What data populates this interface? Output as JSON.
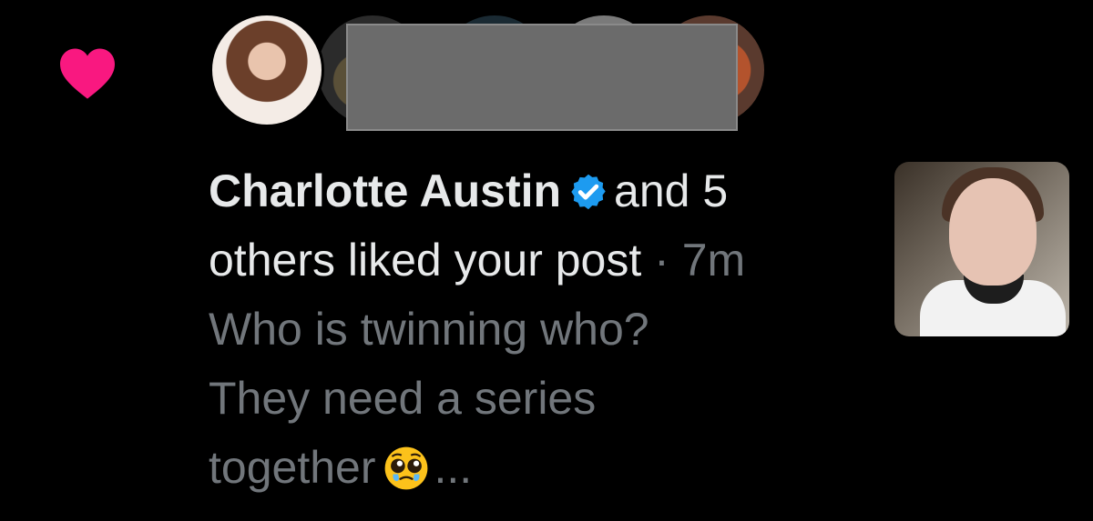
{
  "notification": {
    "type_icon": "heart-icon",
    "user_name": "Charlotte Austin",
    "verified": true,
    "action_prefix": "and 5",
    "action_rest": "others liked your post",
    "separator": "·",
    "time": "7m",
    "post_line1": "Who is twinning who?",
    "post_line2": "They need a series",
    "post_line3": "together",
    "post_emoji": "pleading-face-emoji",
    "ellipsis": "..."
  },
  "colors": {
    "heart": "#f91880",
    "verified": "#1d9bf0",
    "text": "#e7e9ea",
    "muted": "#71767b",
    "background": "#000000"
  }
}
